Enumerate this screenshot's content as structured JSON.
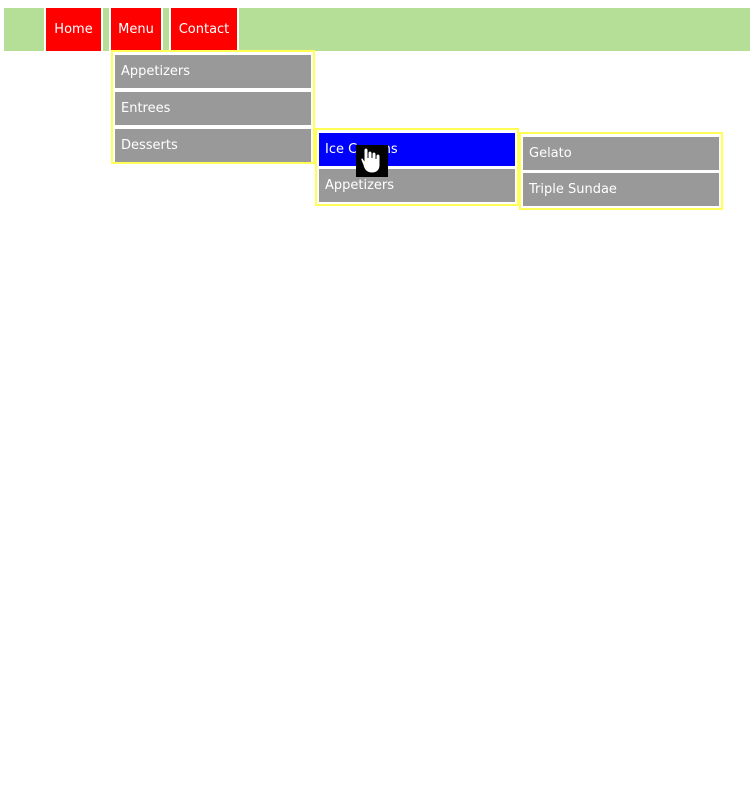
{
  "nav": {
    "items": [
      {
        "label": "Home"
      },
      {
        "label": "Menu"
      },
      {
        "label": "Contact"
      }
    ]
  },
  "menu": {
    "items": [
      {
        "label": "Appetizers"
      },
      {
        "label": "Entrees"
      },
      {
        "label": "Desserts"
      }
    ]
  },
  "desserts": {
    "items": [
      {
        "label": "Ice Creams"
      },
      {
        "label": "Appetizers"
      }
    ]
  },
  "ice_creams": {
    "items": [
      {
        "label": "Gelato"
      },
      {
        "label": "Triple Sundae"
      }
    ]
  },
  "colors": {
    "nav_background": "#b5df97",
    "nav_item": "#ff0000",
    "menu_item": "#999999",
    "menu_item_active": "#0000ff",
    "menu_border": "#ffff55"
  },
  "cursor": {
    "icon": "hand-pointer-icon"
  }
}
